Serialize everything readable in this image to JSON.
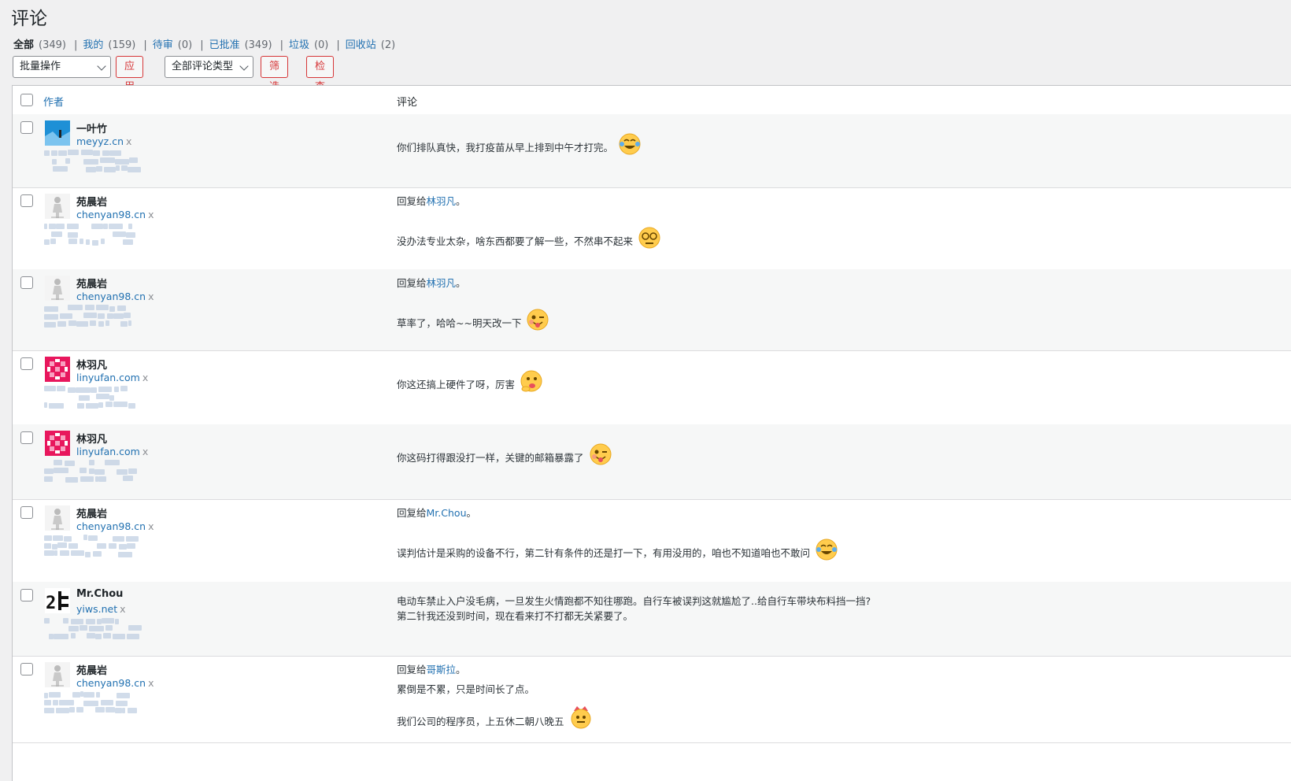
{
  "page": {
    "title": "评论"
  },
  "filters": [
    {
      "label": "全部",
      "count": "(349)",
      "current": true
    },
    {
      "label": "我的",
      "count": "(159)"
    },
    {
      "label": "待审",
      "count": "(0)"
    },
    {
      "label": "已批准",
      "count": "(349)"
    },
    {
      "label": "垃圾",
      "count": "(0)"
    },
    {
      "label": "回收站",
      "count": "(2)"
    }
  ],
  "toolbar": {
    "bulk_action": "批量操作",
    "apply": "应用",
    "comment_type": "全部评论类型",
    "filter": "筛选",
    "check_spam": "检查垃圾"
  },
  "table": {
    "col_author": "作者",
    "col_comment": "评论"
  },
  "comments": [
    {
      "author": "一叶竹",
      "url": "meyyz.cn",
      "x": "x",
      "reply_prefix": "",
      "reply_to": "",
      "reply_suffix": "",
      "text": "你们排队真快，我打疫苗从早上排到中午才打完。",
      "text2": "",
      "emoji": "laugh-cry-emoji"
    },
    {
      "author": "苑晨岩",
      "url": "chenyan98.cn",
      "x": "x",
      "reply_prefix": "回复给",
      "reply_to": "林羽凡",
      "reply_suffix": "。",
      "text": "没办法专业太杂，啥东西都要了解一些，不然串不起来",
      "text2": "",
      "emoji": "dizzy-emoji"
    },
    {
      "author": "苑晨岩",
      "url": "chenyan98.cn",
      "x": "x",
      "reply_prefix": "回复给",
      "reply_to": "林羽凡",
      "reply_suffix": "。",
      "text": "草率了，哈哈~~明天改一下",
      "text2": "",
      "emoji": "wink-tongue-emoji"
    },
    {
      "author": "林羽凡",
      "url": "linyufan.com",
      "x": "x",
      "reply_prefix": "",
      "reply_to": "",
      "reply_suffix": "",
      "text": "你这还搞上硬件了呀，厉害",
      "text2": "",
      "emoji": "thinking-emoji"
    },
    {
      "author": "林羽凡",
      "url": "linyufan.com",
      "x": "x",
      "reply_prefix": "",
      "reply_to": "",
      "reply_suffix": "",
      "text": "你这码打得跟没打一样，关键的邮箱暴露了",
      "text2": "",
      "emoji": "wink-tongue-emoji"
    },
    {
      "author": "苑晨岩",
      "url": "chenyan98.cn",
      "x": "x",
      "reply_prefix": "回复给",
      "reply_to": "Mr.Chou",
      "reply_suffix": "。",
      "text": "误判估计是采购的设备不行，第二针有条件的还是打一下，有用没用的，咱也不知道咱也不敢问",
      "text2": "",
      "emoji": "laugh-cry-emoji"
    },
    {
      "author": "Mr.Chou",
      "url": "yiws.net",
      "x": "x",
      "reply_prefix": "",
      "reply_to": "",
      "reply_suffix": "",
      "text": "电动车禁止入户没毛病，一旦发生火情跑都不知往哪跑。自行车被误判这就尴尬了..给自行车带块布料挡一挡?",
      "text2": "第二针我还没到时间，现在看来打不打都无关紧要了。",
      "emoji": ""
    },
    {
      "author": "苑晨岩",
      "url": "chenyan98.cn",
      "x": "x",
      "reply_prefix": "回复给",
      "reply_to": "哥斯拉",
      "reply_suffix": "。",
      "text": "累倒是不累，只是时间长了点。",
      "text2": "我们公司的程序员，上五休二朝八晚五",
      "emoji": "crowned-emoji"
    }
  ]
}
